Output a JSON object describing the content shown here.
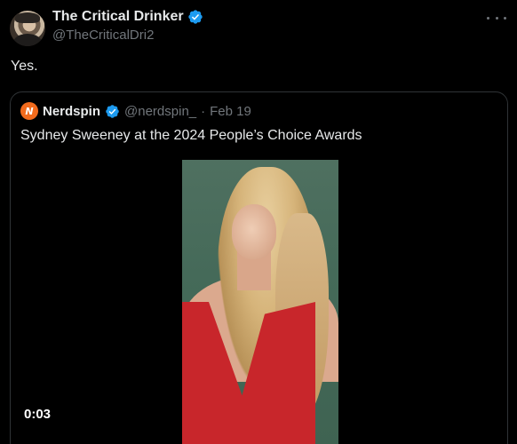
{
  "tweet": {
    "author_name": "The Critical Drinker",
    "handle": "@TheCriticalDri2",
    "text": "Yes."
  },
  "quote": {
    "avatar_letter": "N",
    "author_name": "Nerdspin",
    "handle": "@nerdspin_",
    "separator": "·",
    "date": "Feb 19",
    "text": "Sydney Sweeney at the 2024 People’s Choice Awards",
    "video_timer": "0:03"
  },
  "colors": {
    "background": "#000000",
    "verified": "#1d9bf0",
    "nerdspin_brand": "#f26b1d",
    "secondary_text": "#71767b",
    "border": "#2f3336"
  },
  "icons": {
    "verified": "verified-badge-icon",
    "more": "more-horizontal-icon"
  }
}
